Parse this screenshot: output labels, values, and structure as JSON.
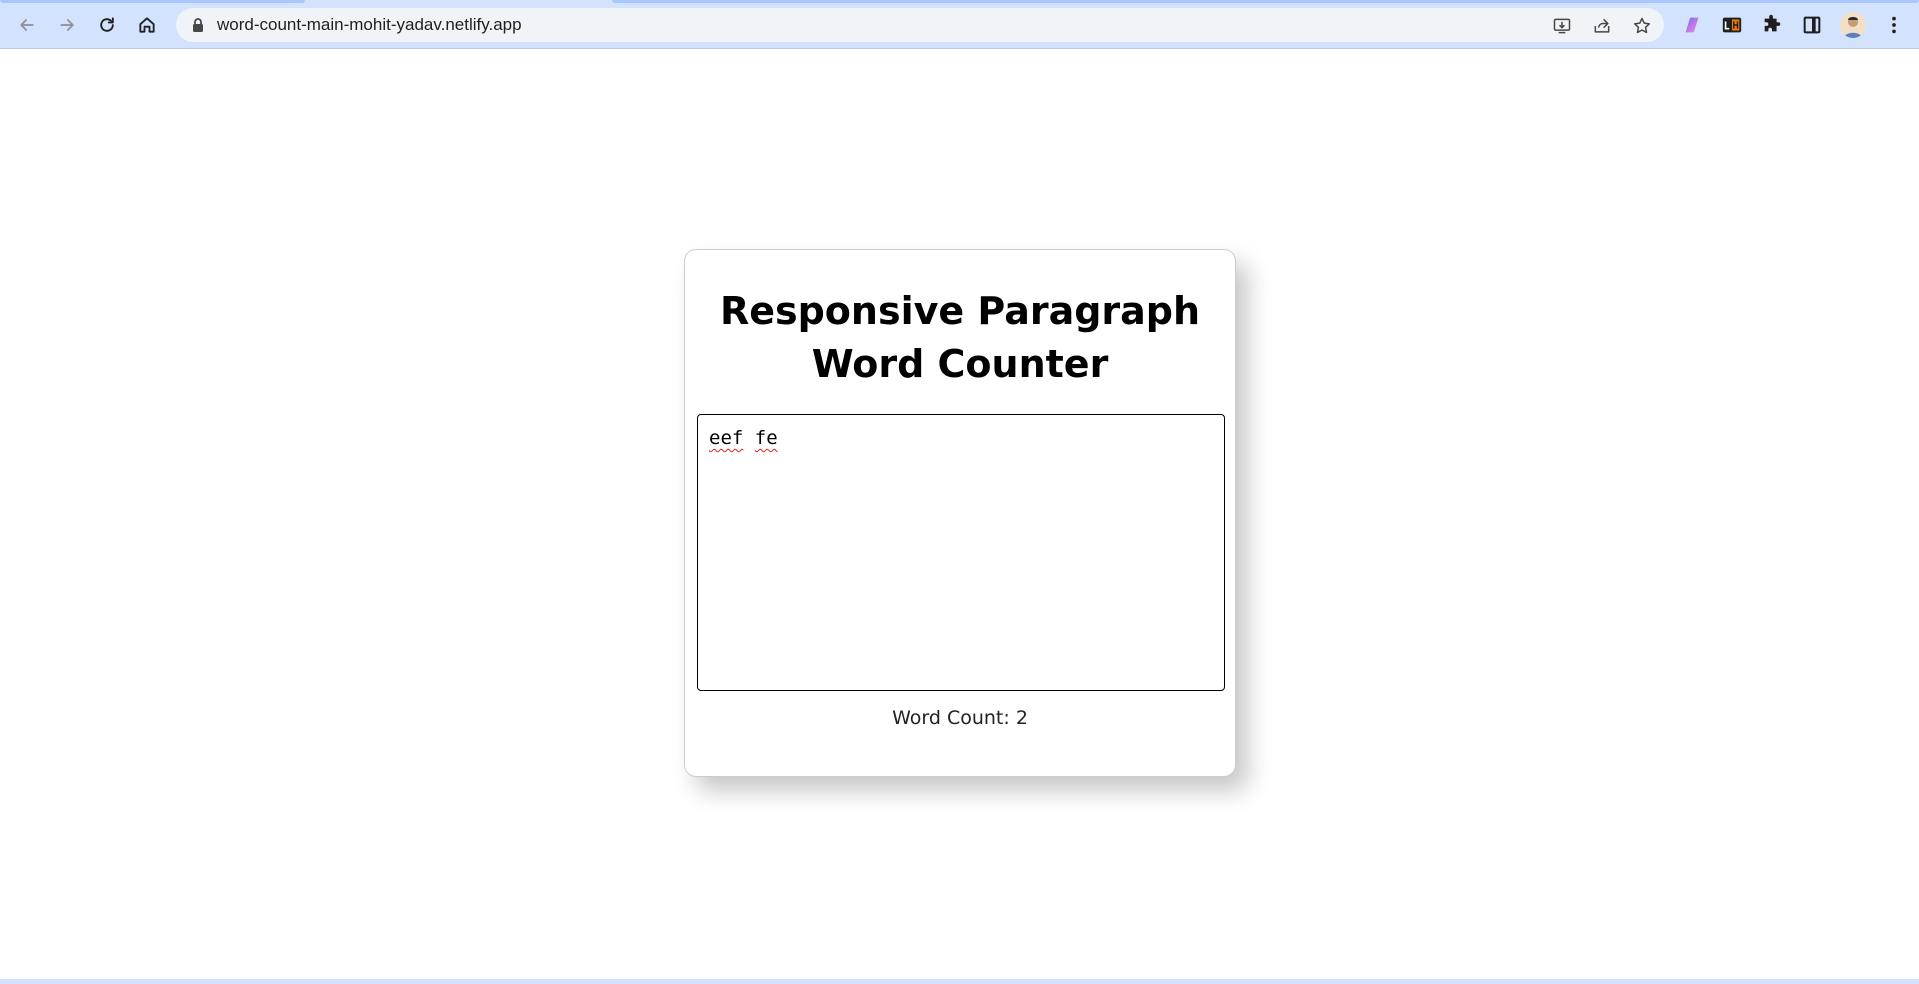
{
  "browser": {
    "url": "word-count-main-mohit-yadav.netlify.app",
    "icons": {
      "back": "arrow-left-icon",
      "forward": "arrow-right-icon",
      "reload": "reload-icon",
      "home": "home-icon",
      "lock": "lock-icon",
      "install": "install-app-icon",
      "share": "share-icon",
      "bookmark": "star-icon",
      "extensions": "puzzle-icon",
      "side_panel": "side-panel-icon",
      "menu": "kebab-menu-icon"
    },
    "colors": {
      "chrome": "#d3e3fd",
      "omnibox": "#f0f4f9"
    }
  },
  "app": {
    "title_line1": "Responsive Paragraph",
    "title_line2": "Word Counter",
    "textarea_words": [
      "eef",
      "fe"
    ],
    "word_count_label": "Word Count: ",
    "word_count_value": "2"
  }
}
